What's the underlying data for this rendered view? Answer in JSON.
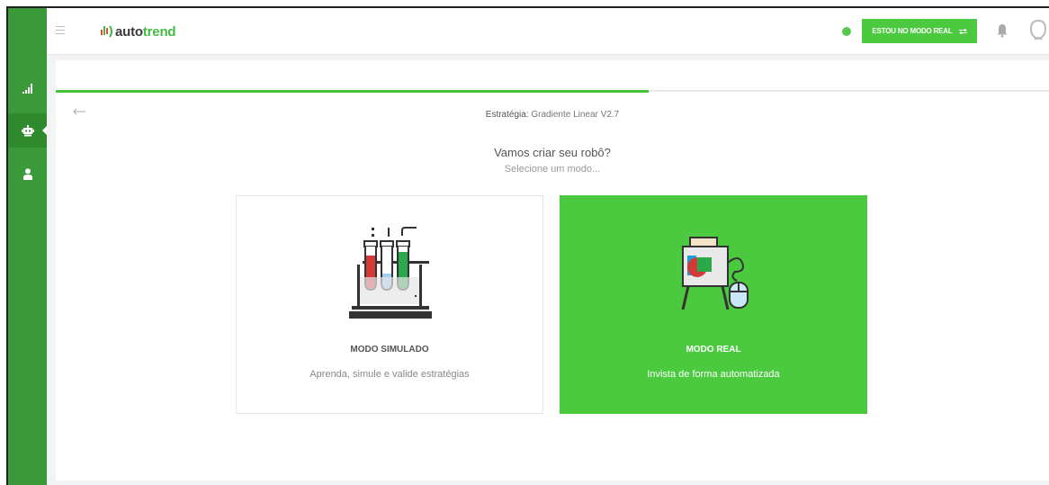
{
  "app": {
    "logo_prefix": "auto",
    "logo_suffix": "trend",
    "mode_button_label": "ESTOU NO MODO REAL",
    "mode_button_icon": "swap-icon",
    "status": "online",
    "status_color": "#57c84d",
    "brand_color": "#4bc93f",
    "sidebar_color": "#3a9a39"
  },
  "sidebar": {
    "items": [
      {
        "name": "stats",
        "icon": "bar-chart-icon"
      },
      {
        "name": "robots",
        "icon": "robot-icon",
        "active": true
      },
      {
        "name": "profile",
        "icon": "user-icon"
      }
    ]
  },
  "wizard": {
    "progress_percent": 60,
    "strategy_label": "Estratégia:",
    "strategy_value": "Gradiente Linear V2.7",
    "headline": "Vamos criar seu robô?",
    "subline": "Selecione um modo..."
  },
  "modes": [
    {
      "id": "simulado",
      "title": "MODO SIMULADO",
      "description": "Aprenda, simule e valide estratégias",
      "icon": "test-tubes-icon",
      "selected": false
    },
    {
      "id": "real",
      "title": "MODO REAL",
      "description": "Invista de forma automatizada",
      "icon": "easel-presentation-icon",
      "selected": true
    }
  ]
}
